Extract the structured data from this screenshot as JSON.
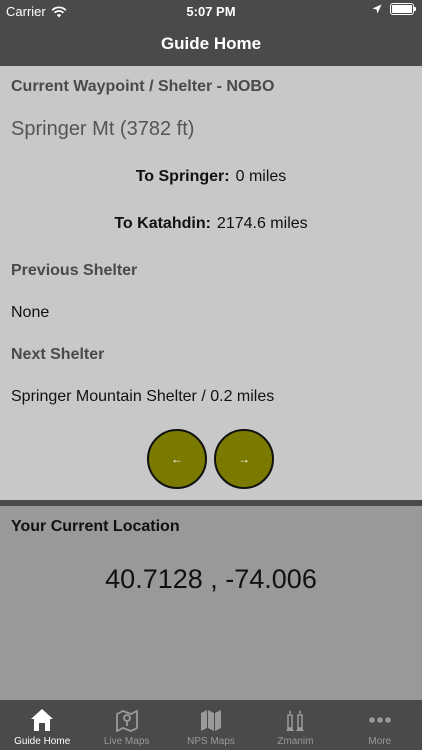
{
  "status_bar": {
    "carrier": "Carrier",
    "time": "5:07 PM"
  },
  "nav": {
    "title": "Guide Home"
  },
  "waypoint": {
    "header": "Current Waypoint / Shelter - NOBO",
    "name": "Springer Mt (3782 ft)",
    "to_springer_label": "To Springer:",
    "to_springer_value": "0 miles",
    "to_katahdin_label": "To Katahdin:",
    "to_katahdin_value": "2174.6 miles",
    "previous_header": "Previous Shelter",
    "previous_value": "None",
    "next_header": "Next Shelter",
    "next_value": "Springer Mountain Shelter / 0.2 miles",
    "prev_button": "←",
    "next_button": "→"
  },
  "location": {
    "header": "Your Current Location",
    "coords": "40.7128 , -74.006"
  },
  "tabs": [
    {
      "label": "Guide Home",
      "icon": "home-icon",
      "active": true
    },
    {
      "label": "Live Maps",
      "icon": "map-pin-icon",
      "active": false
    },
    {
      "label": "NPS Maps",
      "icon": "map-icon",
      "active": false
    },
    {
      "label": "Zmanim",
      "icon": "candles-icon",
      "active": false
    },
    {
      "label": "More",
      "icon": "more-icon",
      "active": false
    }
  ],
  "colors": {
    "bar": "#4a4a4a",
    "button": "#7a7a00",
    "panel": "#c8c8c8",
    "location_panel": "#999999"
  }
}
